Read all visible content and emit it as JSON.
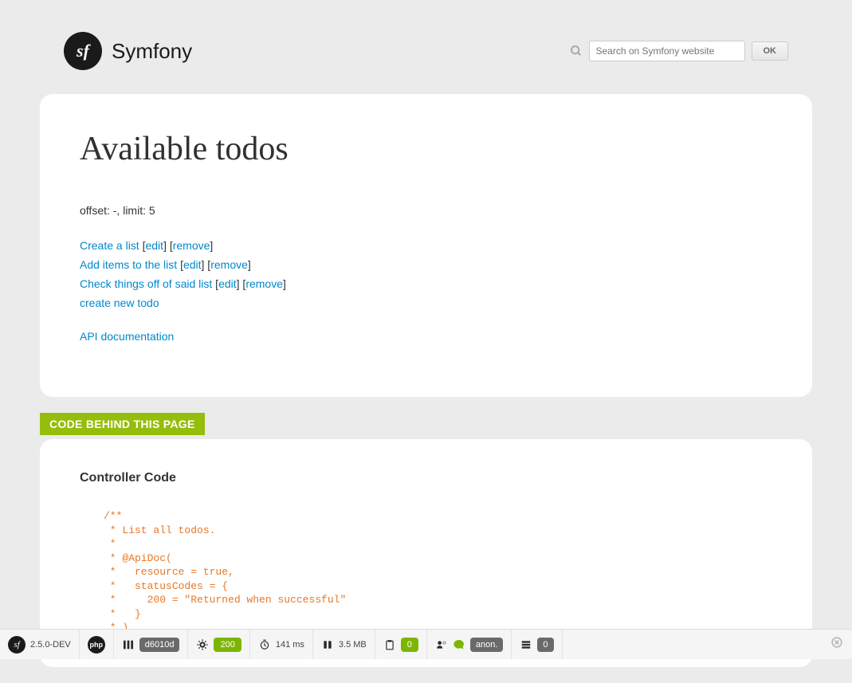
{
  "header": {
    "logo": "Symfony",
    "search_placeholder": "Search on Symfony website",
    "ok_label": "OK"
  },
  "page": {
    "title": "Available todos",
    "pagination": "offset: -, limit: 5",
    "items": [
      {
        "label": "Create a list",
        "edit": "edit",
        "remove": "remove"
      },
      {
        "label": "Add items to the list",
        "edit": "edit",
        "remove": "remove"
      },
      {
        "label": "Check things off of said list",
        "edit": "edit",
        "remove": "remove"
      }
    ],
    "create_new": "create new todo",
    "api_doc": "API documentation"
  },
  "code_section": {
    "label": "CODE BEHIND THIS PAGE",
    "heading": "Controller Code",
    "code": "/**\n * List all todos.\n *\n * @ApiDoc(\n *   resource = true,\n *   statusCodes = {\n *     200 = \"Returned when successful\"\n *   }\n * )"
  },
  "toolbar": {
    "version": "2.5.0-DEV",
    "php": "php",
    "route": "d6010d",
    "status": "200",
    "time": "141 ms",
    "memory": "3.5 MB",
    "forms": "0",
    "user": "anon.",
    "db": "0"
  }
}
